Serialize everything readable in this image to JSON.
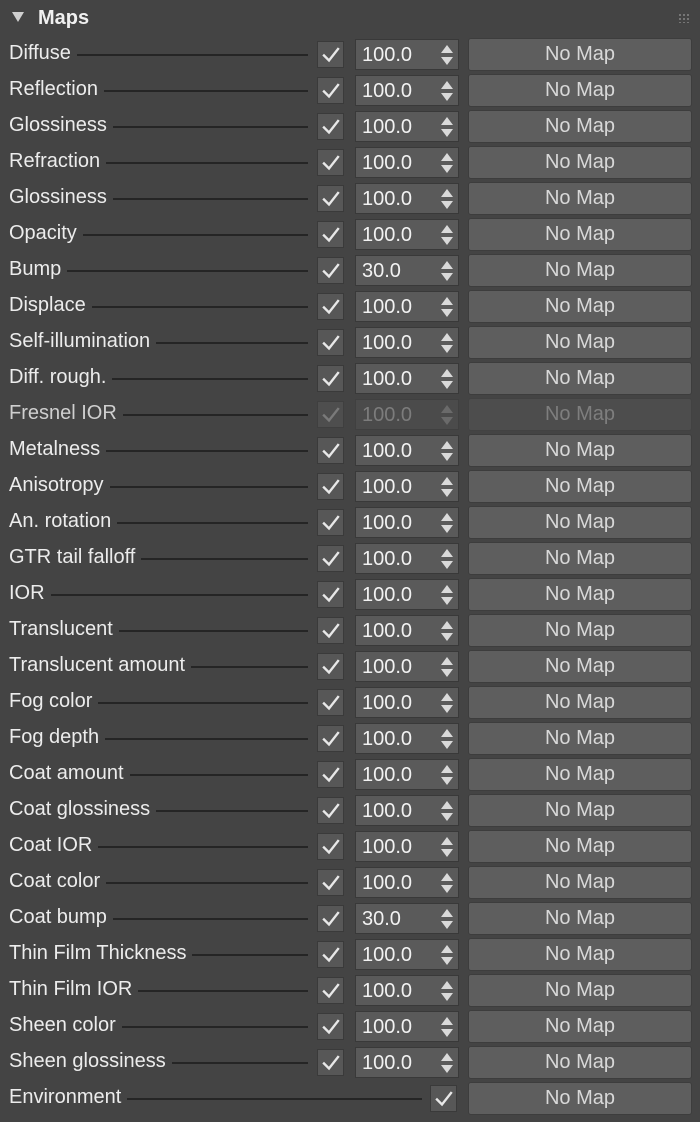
{
  "rollout": {
    "title": "Maps",
    "icons": {
      "collapse": "triangle-down-icon",
      "grip": "grip-dots-icon"
    }
  },
  "rows": [
    {
      "label": "Diffuse",
      "checked": true,
      "value": "100.0",
      "map": "No Map",
      "enabled": true
    },
    {
      "label": "Reflection",
      "checked": true,
      "value": "100.0",
      "map": "No Map",
      "enabled": true
    },
    {
      "label": "Glossiness",
      "checked": true,
      "value": "100.0",
      "map": "No Map",
      "enabled": true
    },
    {
      "label": "Refraction",
      "checked": true,
      "value": "100.0",
      "map": "No Map",
      "enabled": true
    },
    {
      "label": "Glossiness",
      "checked": true,
      "value": "100.0",
      "map": "No Map",
      "enabled": true
    },
    {
      "label": "Opacity",
      "checked": true,
      "value": "100.0",
      "map": "No Map",
      "enabled": true
    },
    {
      "label": "Bump",
      "checked": true,
      "value": "30.0",
      "map": "No Map",
      "enabled": true
    },
    {
      "label": "Displace",
      "checked": true,
      "value": "100.0",
      "map": "No Map",
      "enabled": true
    },
    {
      "label": "Self-illumination",
      "checked": true,
      "value": "100.0",
      "map": "No Map",
      "enabled": true
    },
    {
      "label": "Diff. rough.",
      "checked": true,
      "value": "100.0",
      "map": "No Map",
      "enabled": true
    },
    {
      "label": "Fresnel IOR",
      "checked": true,
      "value": "100.0",
      "map": "No Map",
      "enabled": false
    },
    {
      "label": "Metalness",
      "checked": true,
      "value": "100.0",
      "map": "No Map",
      "enabled": true
    },
    {
      "label": "Anisotropy",
      "checked": true,
      "value": "100.0",
      "map": "No Map",
      "enabled": true
    },
    {
      "label": "An. rotation",
      "checked": true,
      "value": "100.0",
      "map": "No Map",
      "enabled": true
    },
    {
      "label": "GTR tail falloff",
      "checked": true,
      "value": "100.0",
      "map": "No Map",
      "enabled": true
    },
    {
      "label": "IOR",
      "checked": true,
      "value": "100.0",
      "map": "No Map",
      "enabled": true
    },
    {
      "label": "Translucent",
      "checked": true,
      "value": "100.0",
      "map": "No Map",
      "enabled": true
    },
    {
      "label": "Translucent amount",
      "checked": true,
      "value": "100.0",
      "map": "No Map",
      "enabled": true
    },
    {
      "label": "Fog color",
      "checked": true,
      "value": "100.0",
      "map": "No Map",
      "enabled": true
    },
    {
      "label": "Fog depth",
      "checked": true,
      "value": "100.0",
      "map": "No Map",
      "enabled": true
    },
    {
      "label": "Coat amount",
      "checked": true,
      "value": "100.0",
      "map": "No Map",
      "enabled": true
    },
    {
      "label": "Coat glossiness",
      "checked": true,
      "value": "100.0",
      "map": "No Map",
      "enabled": true
    },
    {
      "label": "Coat IOR",
      "checked": true,
      "value": "100.0",
      "map": "No Map",
      "enabled": true
    },
    {
      "label": "Coat color",
      "checked": true,
      "value": "100.0",
      "map": "No Map",
      "enabled": true
    },
    {
      "label": "Coat bump",
      "checked": true,
      "value": "30.0",
      "map": "No Map",
      "enabled": true
    },
    {
      "label": "Thin Film Thickness",
      "checked": true,
      "value": "100.0",
      "map": "No Map",
      "enabled": true
    },
    {
      "label": "Thin Film IOR",
      "checked": true,
      "value": "100.0",
      "map": "No Map",
      "enabled": true
    },
    {
      "label": "Sheen color",
      "checked": true,
      "value": "100.0",
      "map": "No Map",
      "enabled": true
    },
    {
      "label": "Sheen glossiness",
      "checked": true,
      "value": "100.0",
      "map": "No Map",
      "enabled": true
    }
  ],
  "environment": {
    "label": "Environment",
    "checked": true,
    "map": "No Map"
  },
  "colors": {
    "panel_bg": "#444444",
    "button_bg": "#5e5e5e",
    "text": "#ececec",
    "disabled_text": "#7e7e7e"
  },
  "icon_names": {
    "check": "checkmark-icon",
    "spinner": "spinner-arrows-icon"
  }
}
